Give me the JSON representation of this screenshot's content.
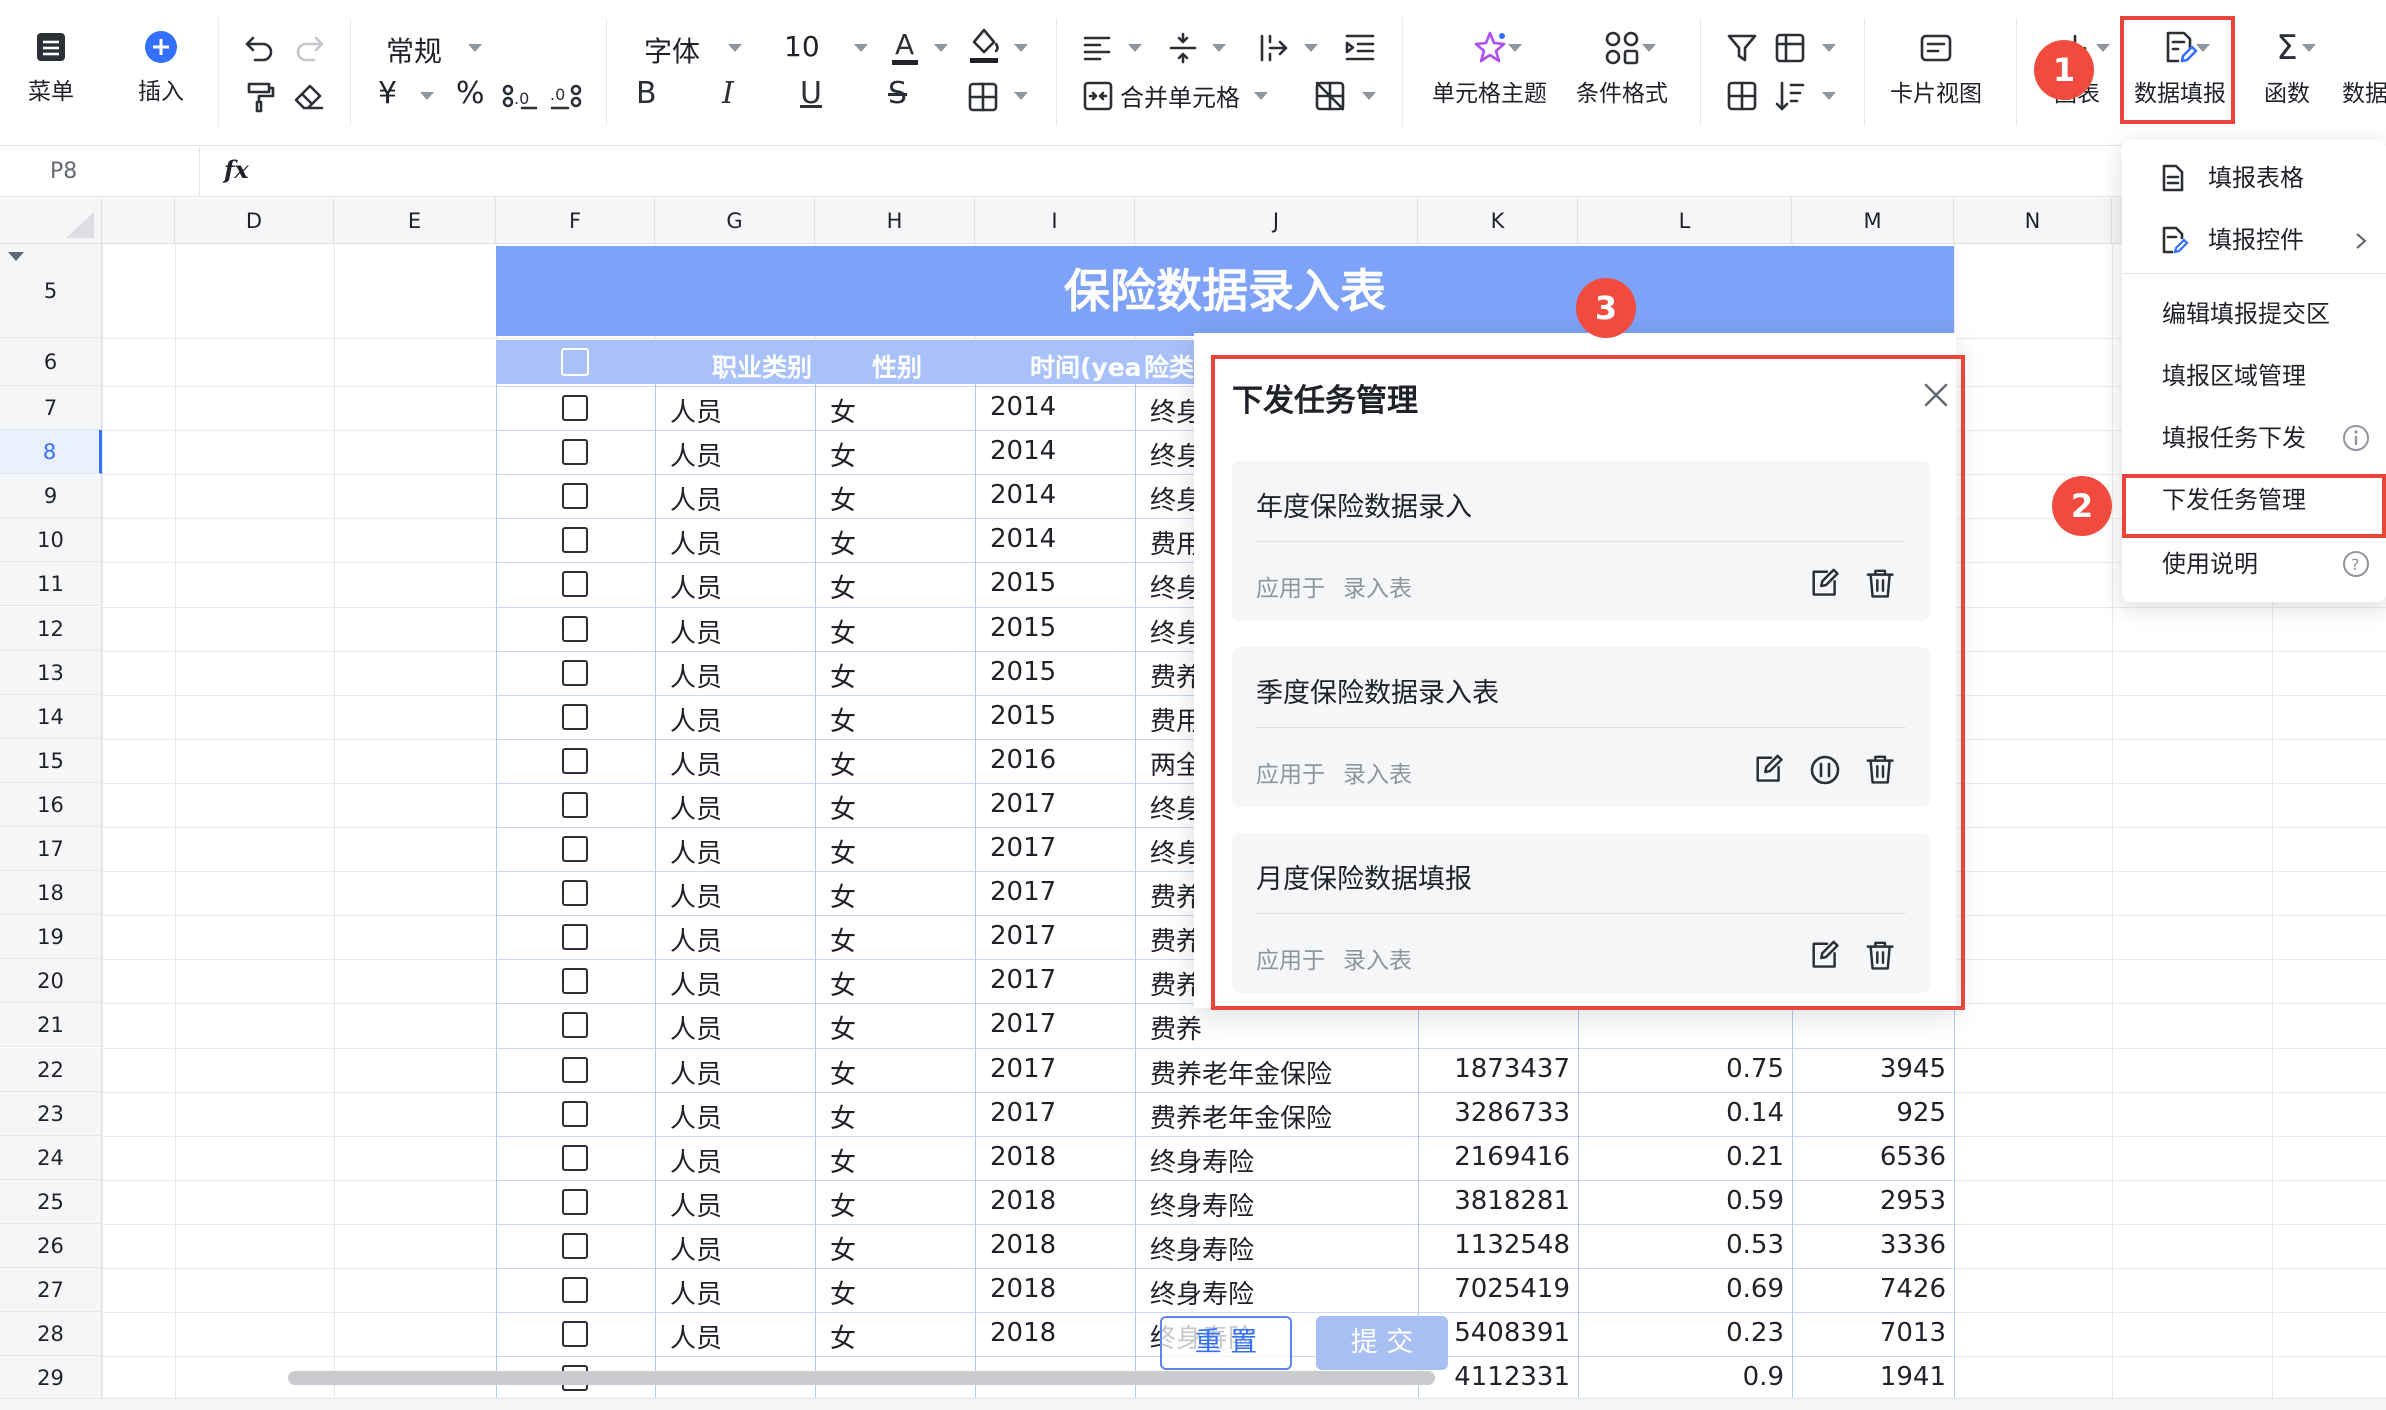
{
  "toolbar": {
    "menu": "菜单",
    "insert": "插入",
    "number_format": "常规",
    "currency_symbol": "¥",
    "percent_symbol": "%",
    "font_name": "字体",
    "font_size": "10",
    "merge_cells": "合并单元格",
    "cell_theme": "单元格主题",
    "conditional_format": "条件格式",
    "card_view": "卡片视图",
    "chart": "图表",
    "data_fill": "数据填报",
    "functions": "函数",
    "data_overflow": "数据"
  },
  "formula_bar": {
    "cell_ref": "P8",
    "fx": "fx"
  },
  "columns": [
    "D",
    "E",
    "F",
    "G",
    "H",
    "I",
    "J",
    "K",
    "L",
    "M",
    "N"
  ],
  "rows": [
    "5",
    "6",
    "7",
    "8",
    "9",
    "10",
    "11",
    "12",
    "13",
    "14",
    "15",
    "16",
    "17",
    "18",
    "19",
    "20",
    "21",
    "22",
    "23",
    "24",
    "25",
    "26",
    "27",
    "28",
    "29"
  ],
  "sheet": {
    "title": "保险数据录入表",
    "headers": {
      "occupation": "职业类别",
      "gender": "性别",
      "time": "时间(yea",
      "type": "险类"
    },
    "data_rows": [
      {
        "occ": "人员",
        "gender": "女",
        "year": "2014",
        "type": "终身"
      },
      {
        "occ": "人员",
        "gender": "女",
        "year": "2014",
        "type": "终身"
      },
      {
        "occ": "人员",
        "gender": "女",
        "year": "2014",
        "type": "终身"
      },
      {
        "occ": "人员",
        "gender": "女",
        "year": "2014",
        "type": "费用"
      },
      {
        "occ": "人员",
        "gender": "女",
        "year": "2015",
        "type": "终身"
      },
      {
        "occ": "人员",
        "gender": "女",
        "year": "2015",
        "type": "终身"
      },
      {
        "occ": "人员",
        "gender": "女",
        "year": "2015",
        "type": "费养"
      },
      {
        "occ": "人员",
        "gender": "女",
        "year": "2015",
        "type": "费用"
      },
      {
        "occ": "人员",
        "gender": "女",
        "year": "2016",
        "type": "两全"
      },
      {
        "occ": "人员",
        "gender": "女",
        "year": "2017",
        "type": "终身"
      },
      {
        "occ": "人员",
        "gender": "女",
        "year": "2017",
        "type": "终身"
      },
      {
        "occ": "人员",
        "gender": "女",
        "year": "2017",
        "type": "费养"
      },
      {
        "occ": "人员",
        "gender": "女",
        "year": "2017",
        "type": "费养"
      },
      {
        "occ": "人员",
        "gender": "女",
        "year": "2017",
        "type": "费养"
      },
      {
        "occ": "人员",
        "gender": "女",
        "year": "2017",
        "type": "费养"
      },
      {
        "occ": "人员",
        "gender": "女",
        "year": "2017",
        "type": "费养老年金保险",
        "k": "1873437",
        "l": "0.75",
        "m": "3945"
      },
      {
        "occ": "人员",
        "gender": "女",
        "year": "2017",
        "type": "费养老年金保险",
        "k": "3286733",
        "l": "0.14",
        "m": "925"
      },
      {
        "occ": "人员",
        "gender": "女",
        "year": "2018",
        "type": "终身寿险",
        "k": "2169416",
        "l": "0.21",
        "m": "6536"
      },
      {
        "occ": "人员",
        "gender": "女",
        "year": "2018",
        "type": "终身寿险",
        "k": "3818281",
        "l": "0.59",
        "m": "2953"
      },
      {
        "occ": "人员",
        "gender": "女",
        "year": "2018",
        "type": "终身寿险",
        "k": "1132548",
        "l": "0.53",
        "m": "3336"
      },
      {
        "occ": "人员",
        "gender": "女",
        "year": "2018",
        "type": "终身寿险",
        "k": "7025419",
        "l": "0.69",
        "m": "7426"
      },
      {
        "occ": "人员",
        "gender": "女",
        "year": "2018",
        "type": "终身寿险",
        "k": "5408391",
        "l": "0.23",
        "m": "7013"
      },
      {
        "occ": "",
        "gender": "",
        "year": "",
        "type": "",
        "k": "4112331",
        "l": "0.9",
        "m": "1941"
      }
    ],
    "reset_button": "重 置",
    "submit_button": "提 交"
  },
  "dropdown_menu": {
    "items": [
      "填报表格",
      "填报控件",
      "编辑填报提交区",
      "填报区域管理",
      "填报任务下发",
      "下发任务管理",
      "使用说明"
    ]
  },
  "dialog": {
    "title": "下发任务管理",
    "applies_to_label": "应用于",
    "tasks": [
      {
        "name": "年度保险数据录入",
        "applies_to": "录入表"
      },
      {
        "name": "季度保险数据录入表",
        "applies_to": "录入表"
      },
      {
        "name": "月度保险数据填报",
        "applies_to": "录入表"
      }
    ]
  },
  "annotations": [
    "1",
    "2",
    "3"
  ],
  "colors": {
    "title_band": "#7ea2f7",
    "header_band": "#a9c1f9",
    "annotation_red": "#e8453b",
    "submit_button": "#a8bff4"
  }
}
